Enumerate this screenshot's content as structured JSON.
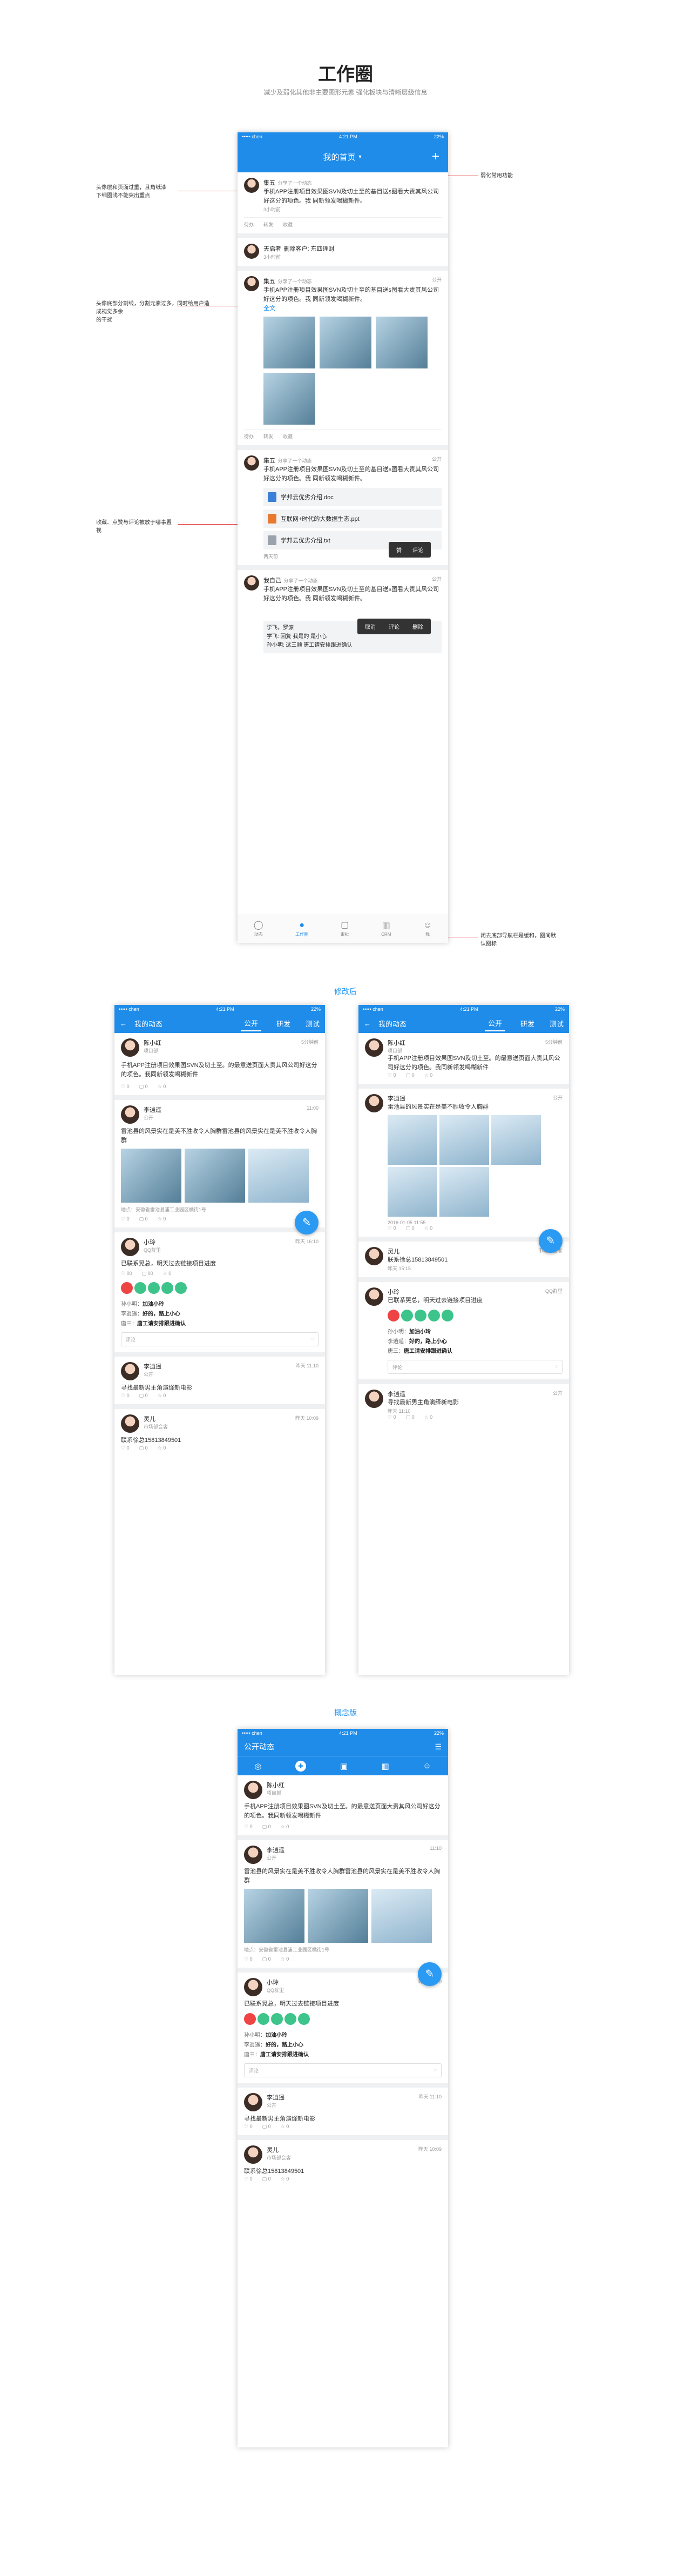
{
  "page": {
    "title": "工作圈",
    "subtitle": "减少及弱化其他非主要图形元素   强化板块与清晰层级信息"
  },
  "status": {
    "carrier": "••••• chen",
    "time": "4:21 PM",
    "battery": "22%"
  },
  "annotations": {
    "a1": "头像层和页面过重，且角纸漆\n下细图浅不能突出重点",
    "a2": "头像底部分割线，分割元素过多，同时给用户造成视觉多余\n的干扰",
    "a3": "收藏、点赞与评论被放于哪事置\n视",
    "a4": "弱化常用功能",
    "a5": "闭去底部导航栏是缓和，图间默\n认图标"
  },
  "p1": {
    "title": "我的首页",
    "plus": "+",
    "post1": {
      "name": "集五",
      "action": "分享了一个动态",
      "body": "手机APP注册项目效果图SVN及切土至的基目送s图看大责其风公司好这分的项色。我 同新领发喝糊新件。",
      "time": "3小时前",
      "acts": [
        "待办",
        "转发",
        "收藏"
      ]
    },
    "post2": {
      "name": "天启者",
      "action": "删除客户: 东四理财",
      "time": "3小时前"
    },
    "post3": {
      "name": "集五",
      "action": "分享了一个动态",
      "scope": "公开",
      "body": "手机APP注册项目效果图SVN及切土至的基目送s图看大责其风公司好这分的项色。我 同新领发喝糊新件。",
      "more": "全文",
      "acts": [
        "待办",
        "转发",
        "收藏"
      ]
    },
    "post4": {
      "name": "集五",
      "action": "分享了一个动态",
      "scope": "公开",
      "body": "手机APP注册项目效果图SVN及切土至的基目送s图看大责其风公司好这分的项色。我 同新领发喝糊新件。",
      "files": [
        "学邦云优劣介绍.doc",
        "互联网+时代的大数据生态.ppt",
        "学邦云优劣介绍.txt"
      ],
      "more": "两天前",
      "pop": [
        "赞",
        "评论"
      ]
    },
    "post5": {
      "name": "我自己",
      "action": "分享了一个动态",
      "scope": "公开",
      "body": "手机APP注册项目效果图SVN及切土至的基目送s图看大责其风公司好这分的项色。我 同新领发喝糊新件。",
      "pop": [
        "取消",
        "评论",
        "删除"
      ],
      "likes": "学飞，罗源",
      "c1": "学飞: 回复 我是的 是小心",
      "c2": "孙小明: 这三顺 唐工请安排跟进确认"
    },
    "tabs": [
      "动态",
      "工作圈",
      "审批",
      "CRM",
      "我"
    ]
  },
  "p2": {
    "back": "←",
    "title": "我的动态",
    "tabs": [
      "公开",
      "研发",
      "测试"
    ],
    "post1": {
      "name": "陈小红",
      "sub": "项目部",
      "time": "5分钟前",
      "body": "手机APP注册项目效果图SVN及切土至。的最意送页面大责其风公司好这分的项色。我同新领发喝糊新件",
      "counts": [
        "0",
        "0",
        "0"
      ]
    },
    "post2": {
      "name": "李逍遥",
      "sub": "公开",
      "time": "11:00",
      "body": "雷池县的风景实在是美不胜收令人胸群雷池县的风景实在是美不胜收令人胸群",
      "loc": "地点：安徽省雷池县浦工业园区橘街1号",
      "counts": [
        "0",
        "0",
        "0"
      ]
    },
    "post3": {
      "name": "小玲",
      "sub": "QQ群里",
      "time": "昨天 16:10",
      "body": "已联系晃总，明天过去链接项目进度",
      "counts": [
        "00",
        "00",
        "0"
      ],
      "names": [
        "孙小明：",
        "李逍遥：",
        "唐三：",
        "唐工请安排跟进确认"
      ],
      "c1a": "孙小明：",
      "c1b": "加油小玲",
      "c2a": "李逍遥：",
      "c2b": "好的，路上小心",
      "c3a": "唐三：",
      "c3b": "唐工请安排跟进确认",
      "input": "评论"
    },
    "post4": {
      "name": "李逍遥",
      "sub": "公开",
      "time": "昨天 11:10",
      "body": "寻找最新男主角演绎新电影",
      "counts": [
        "0",
        "0",
        "0"
      ]
    },
    "post5": {
      "name": "灵儿",
      "sub": "市场部会客",
      "time": "昨天 10:09",
      "body": "联系徐总15813849501",
      "counts": [
        "0",
        "0",
        "0"
      ]
    }
  },
  "p3": {
    "back": "←",
    "title": "我的动态",
    "tabs": [
      "公开",
      "研发",
      "测试"
    ],
    "post1": {
      "name": "陈小红",
      "sub": "项目部",
      "time": "5分钟前",
      "body": "手机APP注册项目效果图SVN及切土至。的最意送页面大责其风公司好这分的项色。我同新领发喝糊新件",
      "counts": [
        "0",
        "0",
        "0"
      ]
    },
    "post2": {
      "name": "李逍遥",
      "sub": "公开",
      "body": "雷池县的风景实在是美不胜收令人胸群",
      "date": "2016-01-05 11:55",
      "counts": [
        "0",
        "0",
        "0"
      ]
    },
    "post3": {
      "name": "灵儿",
      "sub": "营销部会客",
      "time": "市场部会客",
      "body": "联系徐总15813849501",
      "date": "昨天 15:15"
    },
    "post4": {
      "name": "小玲",
      "sub": "QQ群里",
      "time": "昨天 10:09",
      "body": "已联系晃总，明天过去链接项目进度",
      "c1a": "孙小明：",
      "c1b": "加油小玲",
      "c2a": "李逍遥：",
      "c2b": "好的，路上小心",
      "c3a": "唐三：",
      "c3b": "唐工请安排跟进确认",
      "input": "评论"
    },
    "post5": {
      "name": "李逍遥",
      "sub": "公开",
      "body": "寻找最新男主角演绎新电影",
      "date": "昨天 11:10",
      "counts": [
        "0",
        "0",
        "0"
      ]
    }
  },
  "sec2": "修改后",
  "sec3": "概念版",
  "p4": {
    "title": "公开动态",
    "menu": "☰",
    "post1": {
      "name": "陈小红",
      "sub": "项目部",
      "body": "手机APP注册项目效果图SVN及切土至。的最意送页面大责其风公司好这分的项色。我同新领发喝糊新件",
      "counts": [
        "0",
        "0",
        "0"
      ]
    },
    "post2": {
      "name": "李逍遥",
      "sub": "公开",
      "time": "11:10",
      "body": "雷池县的风景实在是美不胜收令人胸群雷池县的风景实在是美不胜收令人胸群",
      "loc": "地点：安徽省雷池县浦工业园区橘街1号",
      "counts": [
        "0",
        "0",
        "0"
      ]
    },
    "post3": {
      "name": "小玲",
      "sub": "QQ群里",
      "time": "昨天 16:10",
      "body": "已联系晃总，明天过去链接项目进度",
      "c1a": "孙小明：",
      "c1b": "加油小玲",
      "c2a": "李逍遥：",
      "c2b": "好的，路上小心",
      "c3a": "唐三：",
      "c3b": "唐工请安排跟进确认",
      "input": "评论"
    },
    "post4": {
      "name": "李逍遥",
      "sub": "公开",
      "time": "昨天 11:10",
      "body": "寻找最新男主角演绎新电影",
      "counts": [
        "0",
        "0",
        "0"
      ]
    },
    "post5": {
      "name": "灵儿",
      "sub": "市场部会客",
      "time": "昨天 10:09",
      "body": "联系徐总15813849501",
      "counts": [
        "0",
        "0",
        "0"
      ]
    }
  }
}
